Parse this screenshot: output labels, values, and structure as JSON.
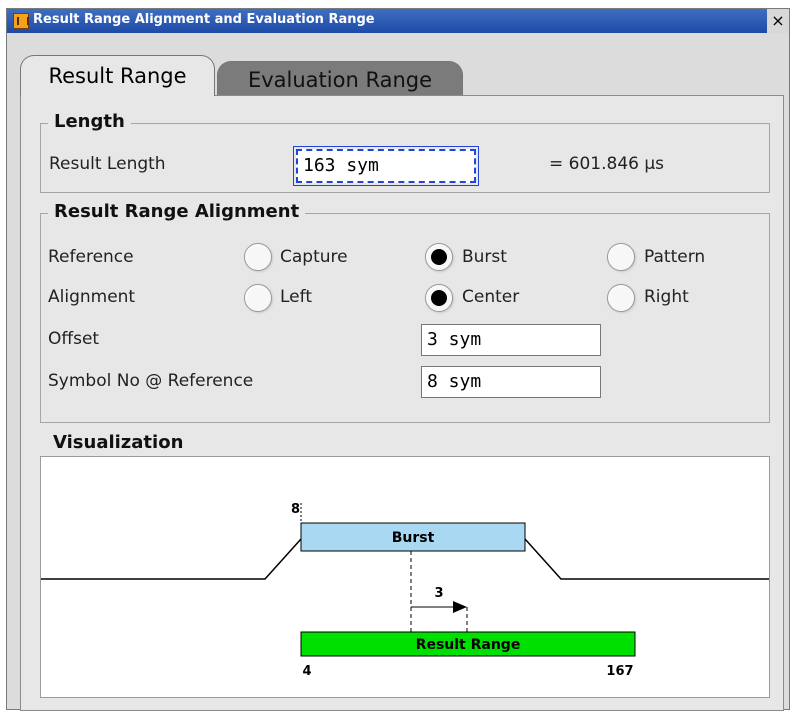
{
  "window": {
    "title": "Result Range Alignment and Evaluation Range",
    "close_glyph": "×"
  },
  "tabs": [
    {
      "label": "Result Range",
      "active": true
    },
    {
      "label": "Evaluation Range",
      "active": false
    }
  ],
  "length": {
    "legend": "Length",
    "result_length_label": "Result Length",
    "result_length_value": "163 sym",
    "result_length_time": "= 601.846 µs"
  },
  "alignment": {
    "legend": "Result Range Alignment",
    "reference_label": "Reference",
    "reference_options": [
      {
        "label": "Capture",
        "selected": false
      },
      {
        "label": "Burst",
        "selected": true
      },
      {
        "label": "Pattern",
        "selected": false
      }
    ],
    "alignment_label": "Alignment",
    "alignment_options": [
      {
        "label": "Left",
        "selected": false
      },
      {
        "label": "Center",
        "selected": true
      },
      {
        "label": "Right",
        "selected": false
      }
    ],
    "offset_label": "Offset",
    "offset_value": "3 sym",
    "symbol_label": "Symbol No @ Reference",
    "symbol_value": "8 sym"
  },
  "visualization": {
    "legend": "Visualization",
    "burst_label": "Burst",
    "range_label": "Result Range",
    "ref_symbol": "8",
    "offset": "3",
    "range_start": "4",
    "range_end": "167",
    "colors": {
      "burst": "#a8d8f2",
      "range": "#00e000"
    }
  }
}
